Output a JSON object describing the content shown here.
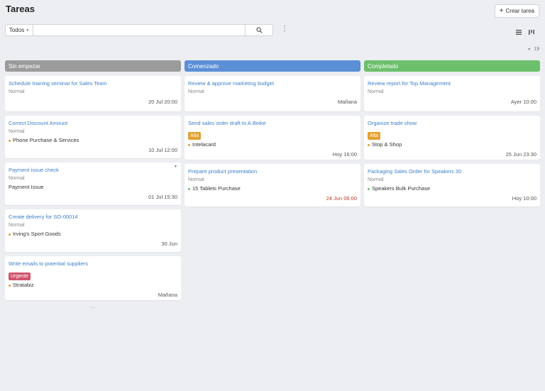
{
  "header": {
    "title": "Tareas",
    "create_label": "Crear tarea"
  },
  "filter": {
    "selected": "Todos",
    "search_placeholder": "",
    "search_value": ""
  },
  "count": "19",
  "colors": {
    "not_started": "#9b9b9b",
    "started": "#5b8fd6",
    "completed": "#6cc06c",
    "alta": "#e3a030",
    "urgente": "#d0546e",
    "title_link": "#3b7fc9",
    "overdue": "#c0392b"
  },
  "columns": [
    {
      "label": "Sin empezar",
      "cards": [
        {
          "title": "Schedule training seminar for Sales Team",
          "priority": "Normal",
          "date": "20 Jul 20:00"
        },
        {
          "title": "Correct Discount Amount",
          "priority": "Normal",
          "client": "Phone Purchase & Services",
          "date": "10 Jul 12:00"
        },
        {
          "title": "Payment issue check",
          "priority": "Normal",
          "client": "Payment Issue",
          "date": "01 Jul 15:30"
        },
        {
          "title": "Create delivery for SO-00014",
          "priority": "Normal",
          "client": "Irving's Sport Goods",
          "date": "30 Jun"
        },
        {
          "title": "Write emails to potential suppliers",
          "badge": "Urgente",
          "client": "Stratabiz",
          "date": "Mañana"
        }
      ],
      "more": "..."
    },
    {
      "label": "Comenzado",
      "cards": [
        {
          "title": "Review & approve marketing budget",
          "priority": "Normal",
          "date": "Mañana"
        },
        {
          "title": "Send sales order draft to A.Beike",
          "badge": "Alta",
          "client": "Intelacard",
          "date": "Hoy 16:00"
        },
        {
          "title": "Prepare product presentation",
          "priority": "Normal",
          "client": "15 Tablets Purchase",
          "date": "24 Jun 06:00"
        }
      ]
    },
    {
      "label": "Completado",
      "cards": [
        {
          "title": "Review report for Top Management",
          "priority": "Normal",
          "date": "Ayer 10:00"
        },
        {
          "title": "Organize trade show",
          "badge": "Alta",
          "client": "Stop & Shop",
          "date": "25 Jun 23:30"
        },
        {
          "title": "Packaging Sales Order for Speakers 30",
          "priority": "Normal",
          "client": "Speakers Bulk Purchase",
          "date": "Hoy 10:00"
        }
      ]
    }
  ]
}
